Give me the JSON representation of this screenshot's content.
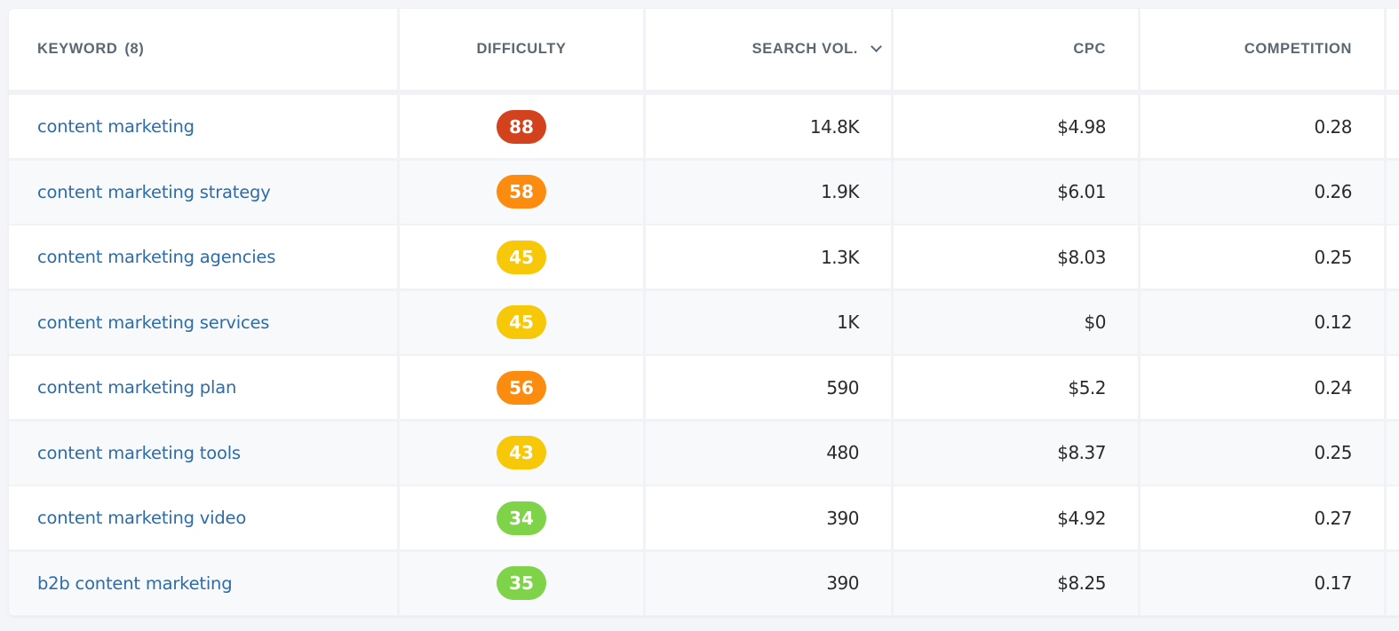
{
  "table": {
    "headers": {
      "keyword": "KEYWORD",
      "keyword_count": "(8)",
      "difficulty": "DIFFICULTY",
      "search_volume": "SEARCH VOL.",
      "cpc": "CPC",
      "competition": "COMPETITION"
    },
    "sort": {
      "column": "search_volume",
      "direction": "descending",
      "icon": "chevron-down-icon"
    },
    "difficulty_colors": {
      "very_hard": "#d2421c",
      "hard": "#fb8c0f",
      "medium": "#f6c808",
      "easy": "#7ed348"
    },
    "rows": [
      {
        "keyword": "content marketing",
        "difficulty": "88",
        "difficulty_level": "very_hard",
        "difficulty_color": "#d2421c",
        "search_volume": "14.8K",
        "cpc": "$4.98",
        "competition": "0.28"
      },
      {
        "keyword": "content marketing strategy",
        "difficulty": "58",
        "difficulty_level": "hard",
        "difficulty_color": "#fb8c0f",
        "search_volume": "1.9K",
        "cpc": "$6.01",
        "competition": "0.26"
      },
      {
        "keyword": "content marketing agencies",
        "difficulty": "45",
        "difficulty_level": "medium",
        "difficulty_color": "#f6c808",
        "search_volume": "1.3K",
        "cpc": "$8.03",
        "competition": "0.25"
      },
      {
        "keyword": "content marketing services",
        "difficulty": "45",
        "difficulty_level": "medium",
        "difficulty_color": "#f6c808",
        "search_volume": "1K",
        "cpc": "$0",
        "competition": "0.12"
      },
      {
        "keyword": "content marketing plan",
        "difficulty": "56",
        "difficulty_level": "hard",
        "difficulty_color": "#fb8c0f",
        "search_volume": "590",
        "cpc": "$5.2",
        "competition": "0.24"
      },
      {
        "keyword": "content marketing tools",
        "difficulty": "43",
        "difficulty_level": "medium",
        "difficulty_color": "#f6c808",
        "search_volume": "480",
        "cpc": "$8.37",
        "competition": "0.25"
      },
      {
        "keyword": "content marketing video",
        "difficulty": "34",
        "difficulty_level": "easy",
        "difficulty_color": "#7ed348",
        "search_volume": "390",
        "cpc": "$4.92",
        "competition": "0.27"
      },
      {
        "keyword": "b2b content marketing",
        "difficulty": "35",
        "difficulty_level": "easy",
        "difficulty_color": "#7ed348",
        "search_volume": "390",
        "cpc": "$8.25",
        "competition": "0.17"
      }
    ]
  }
}
